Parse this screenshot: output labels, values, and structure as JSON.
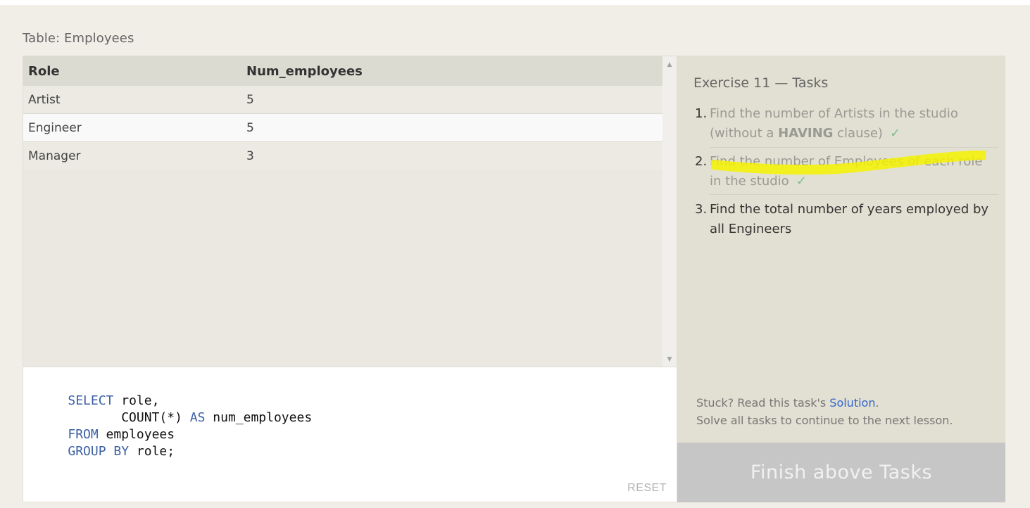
{
  "table": {
    "title": "Table: Employees",
    "columns": [
      "Role",
      "Num_employees"
    ],
    "rows": [
      [
        "Artist",
        "5"
      ],
      [
        "Engineer",
        "5"
      ],
      [
        "Manager",
        "3"
      ]
    ]
  },
  "editor": {
    "lines": [
      [
        {
          "t": "SELECT",
          "kw": true
        },
        {
          "t": " role,",
          "kw": false
        }
      ],
      [
        {
          "t": "       COUNT(*) ",
          "kw": false
        },
        {
          "t": "AS",
          "kw": true
        },
        {
          "t": " num_employees",
          "kw": false
        }
      ],
      [
        {
          "t": "FROM",
          "kw": true
        },
        {
          "t": " employees",
          "kw": false
        }
      ],
      [
        {
          "t": "GROUP BY",
          "kw": true
        },
        {
          "t": " role;",
          "kw": false
        }
      ]
    ],
    "reset_label": "RESET"
  },
  "tasks": {
    "title": "Exercise 11 — Tasks",
    "items": [
      {
        "num": "1.",
        "text_a": "Find the number of Artists in the studio (without a ",
        "bold": "HAVING",
        "text_b": " clause)",
        "done": true,
        "check": "✓"
      },
      {
        "num": "2.",
        "text_a": "Find the number of Employees of each role in the studio",
        "bold": "",
        "text_b": "",
        "done": true,
        "check": "✓"
      },
      {
        "num": "3.",
        "text_a": "Find the total number of years employed by all Engineers",
        "bold": "",
        "text_b": "",
        "done": false,
        "check": ""
      }
    ],
    "help_prefix": "Stuck? Read this task's ",
    "help_link": "Solution",
    "help_suffix": ".",
    "help_line2": "Solve all tasks to continue to the next lesson.",
    "finish_label": "Finish above Tasks"
  },
  "colors": {
    "keyword": "#3b5fa3",
    "check": "#7dbf8e",
    "highlight": "#f5f200",
    "link": "#3366cc"
  }
}
